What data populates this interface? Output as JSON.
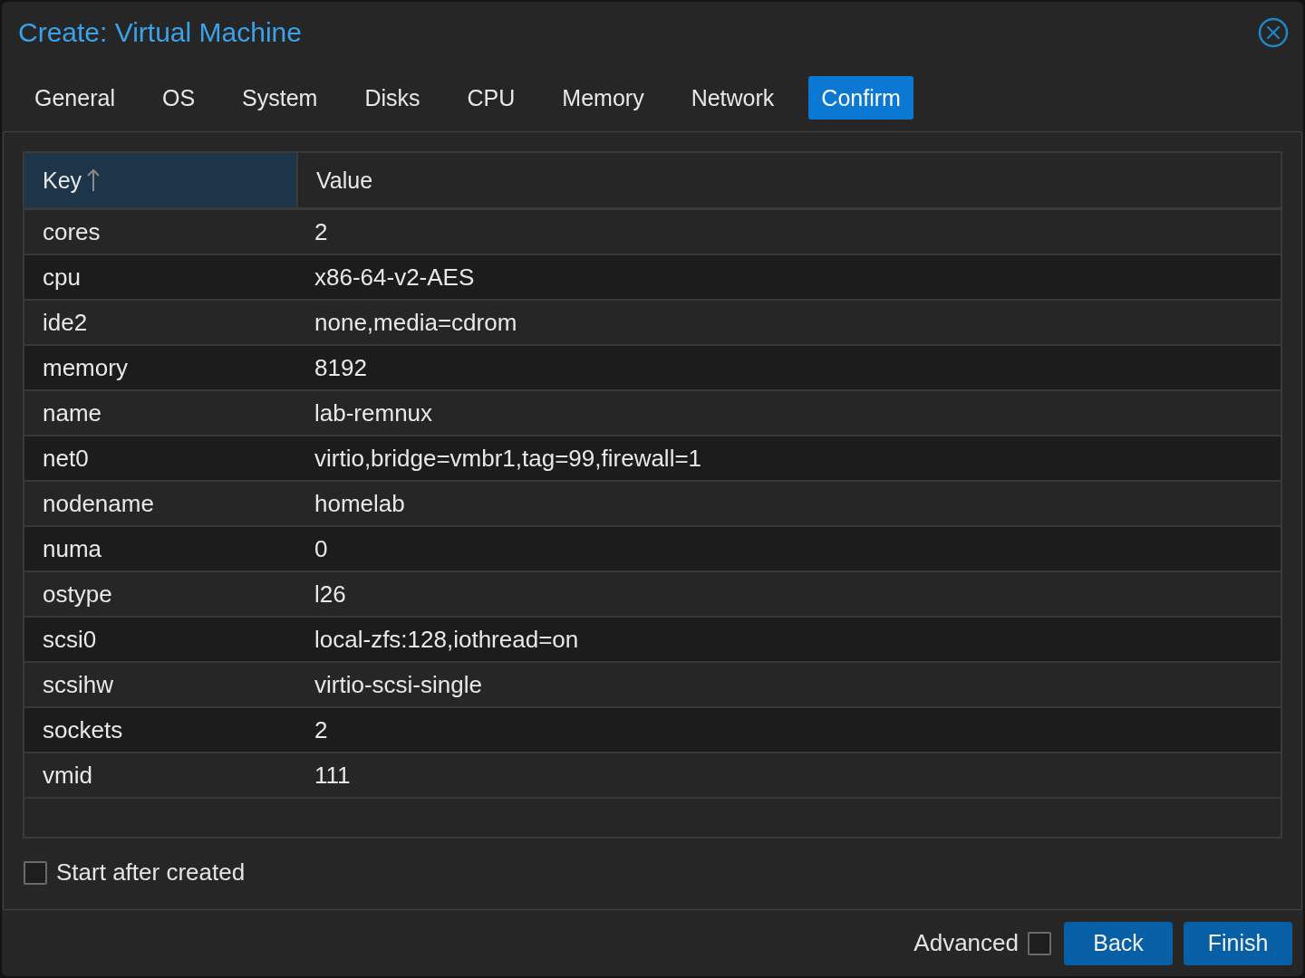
{
  "window": {
    "title": "Create: Virtual Machine"
  },
  "tabs": [
    {
      "label": "General",
      "selected": false
    },
    {
      "label": "OS",
      "selected": false
    },
    {
      "label": "System",
      "selected": false
    },
    {
      "label": "Disks",
      "selected": false
    },
    {
      "label": "CPU",
      "selected": false
    },
    {
      "label": "Memory",
      "selected": false
    },
    {
      "label": "Network",
      "selected": false
    },
    {
      "label": "Confirm",
      "selected": true
    }
  ],
  "table": {
    "columns": [
      {
        "label": "Key",
        "sorted": true
      },
      {
        "label": "Value",
        "sorted": false
      }
    ],
    "rows": [
      {
        "key": "cores",
        "value": "2"
      },
      {
        "key": "cpu",
        "value": "x86-64-v2-AES"
      },
      {
        "key": "ide2",
        "value": "none,media=cdrom"
      },
      {
        "key": "memory",
        "value": "8192"
      },
      {
        "key": "name",
        "value": "lab-remnux"
      },
      {
        "key": "net0",
        "value": "virtio,bridge=vmbr1,tag=99,firewall=1"
      },
      {
        "key": "nodename",
        "value": "homelab"
      },
      {
        "key": "numa",
        "value": "0"
      },
      {
        "key": "ostype",
        "value": "l26"
      },
      {
        "key": "scsi0",
        "value": "local-zfs:128,iothread=on"
      },
      {
        "key": "scsihw",
        "value": "virtio-scsi-single"
      },
      {
        "key": "sockets",
        "value": "2"
      },
      {
        "key": "vmid",
        "value": "111"
      }
    ]
  },
  "start_after_created": {
    "label": "Start after created",
    "checked": false
  },
  "footer": {
    "advanced": {
      "label": "Advanced",
      "checked": false
    },
    "buttons": [
      "Back",
      "Finish"
    ]
  }
}
